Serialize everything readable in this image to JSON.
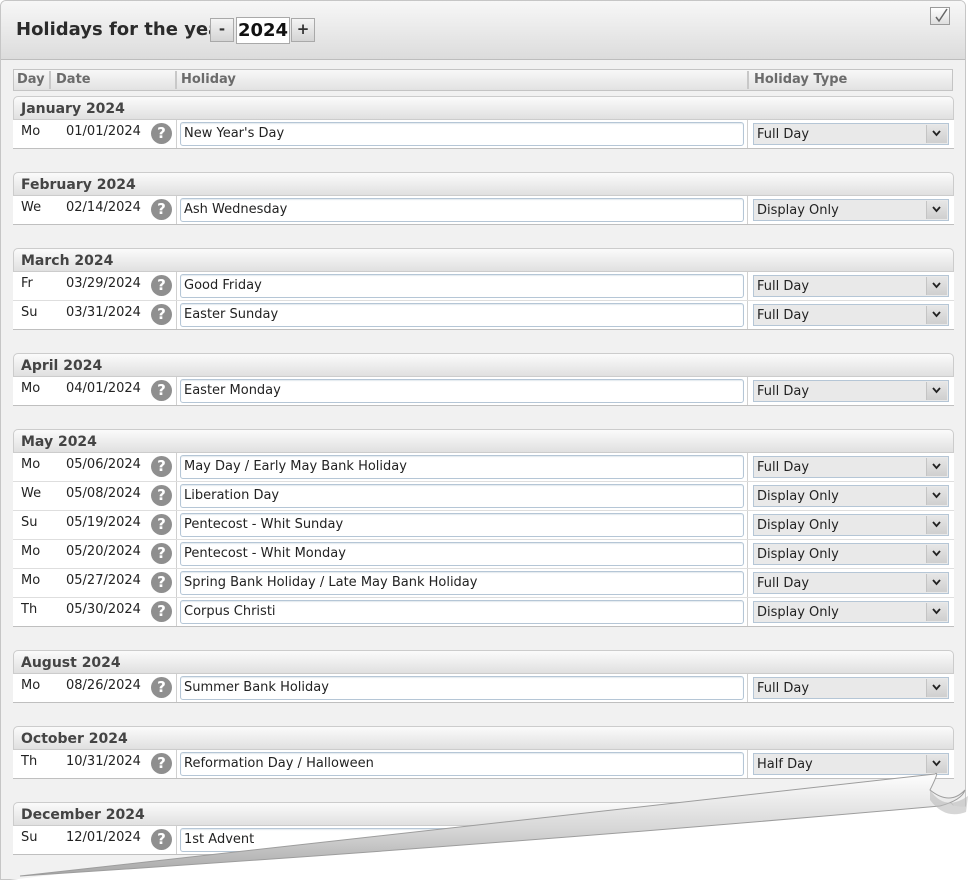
{
  "header": {
    "title": "Holidays for the year",
    "year": "2024",
    "decrement_label": "-",
    "increment_label": "+",
    "close_icon": "checkbox-check-icon"
  },
  "columns": {
    "day": "Day",
    "date": "Date",
    "holiday": "Holiday",
    "type": "Holiday Type"
  },
  "help_glyph": "?",
  "groups": [
    {
      "month": "January 2024",
      "rows": [
        {
          "day": "Mo",
          "date": "01/01/2024",
          "name": "New Year's Day",
          "type": "Full Day"
        }
      ]
    },
    {
      "month": "February 2024",
      "rows": [
        {
          "day": "We",
          "date": "02/14/2024",
          "name": "Ash Wednesday",
          "type": "Display Only"
        }
      ]
    },
    {
      "month": "March 2024",
      "rows": [
        {
          "day": "Fr",
          "date": "03/29/2024",
          "name": "Good Friday",
          "type": "Full Day"
        },
        {
          "day": "Su",
          "date": "03/31/2024",
          "name": "Easter Sunday",
          "type": "Full Day"
        }
      ]
    },
    {
      "month": "April 2024",
      "rows": [
        {
          "day": "Mo",
          "date": "04/01/2024",
          "name": "Easter Monday",
          "type": "Full Day"
        }
      ]
    },
    {
      "month": "May 2024",
      "rows": [
        {
          "day": "Mo",
          "date": "05/06/2024",
          "name": "May Day / Early May Bank Holiday",
          "type": "Full Day"
        },
        {
          "day": "We",
          "date": "05/08/2024",
          "name": "Liberation Day",
          "type": "Display Only"
        },
        {
          "day": "Su",
          "date": "05/19/2024",
          "name": "Pentecost - Whit Sunday",
          "type": "Display Only"
        },
        {
          "day": "Mo",
          "date": "05/20/2024",
          "name": "Pentecost - Whit Monday",
          "type": "Display Only"
        },
        {
          "day": "Mo",
          "date": "05/27/2024",
          "name": "Spring Bank Holiday / Late May Bank Holiday",
          "type": "Full Day"
        },
        {
          "day": "Th",
          "date": "05/30/2024",
          "name": "Corpus Christi",
          "type": "Display Only"
        }
      ]
    },
    {
      "month": "August 2024",
      "rows": [
        {
          "day": "Mo",
          "date": "08/26/2024",
          "name": "Summer Bank Holiday",
          "type": "Full Day"
        }
      ]
    },
    {
      "month": "October 2024",
      "rows": [
        {
          "day": "Th",
          "date": "10/31/2024",
          "name": "Reformation Day / Halloween",
          "type": "Half Day"
        }
      ]
    },
    {
      "month": "December 2024",
      "rows": [
        {
          "day": "Su",
          "date": "12/01/2024",
          "name": "1st Advent",
          "type": ""
        }
      ]
    }
  ]
}
